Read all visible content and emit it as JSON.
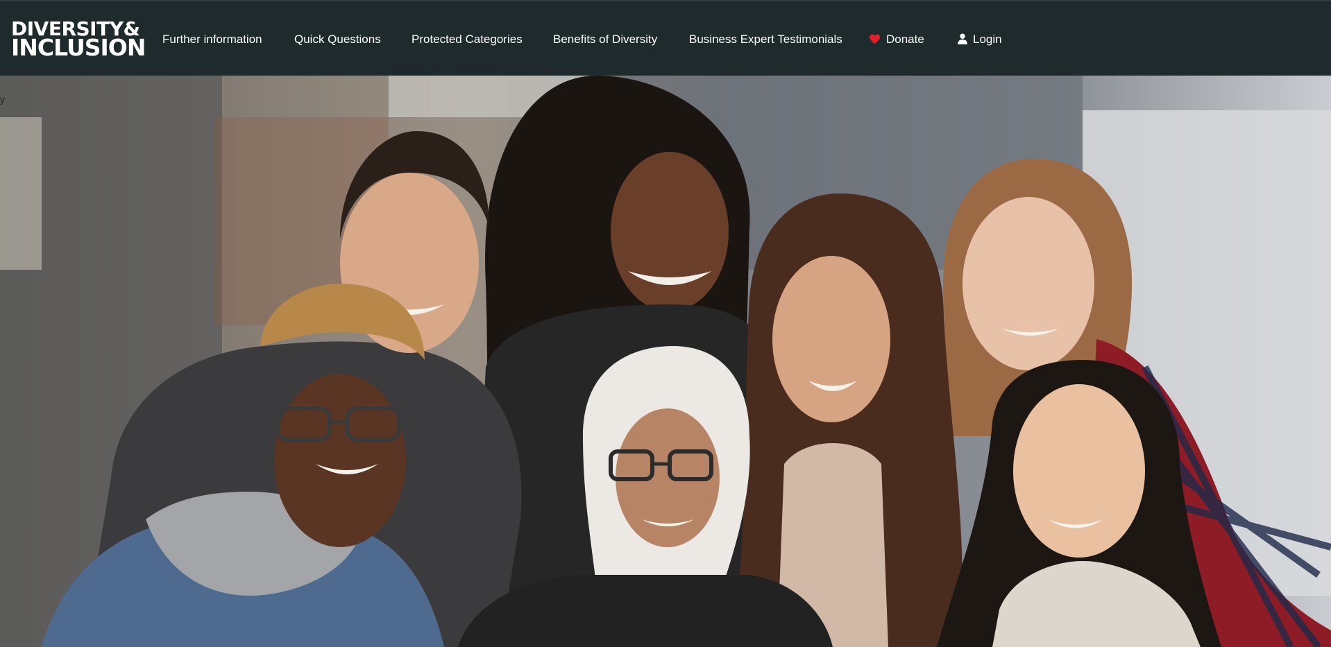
{
  "brand": {
    "logo_line1": "DIVERSITY&",
    "logo_line2": "INCLUSION"
  },
  "nav": {
    "items": [
      {
        "label": "Further information"
      },
      {
        "label": "Quick Questions"
      },
      {
        "label": "Protected Categories"
      },
      {
        "label": "Benefits of Diversity"
      },
      {
        "label": "Business Expert Testimonials"
      },
      {
        "label": "Donate",
        "icon": "heart-icon"
      },
      {
        "label": "Login",
        "icon": "user-icon"
      }
    ]
  },
  "hero": {
    "image": "group-photo",
    "partial_text": "y"
  },
  "colors": {
    "navbar_bg": "#1e2a2b",
    "nav_text": "#ffffff",
    "heart": "#e0202a"
  }
}
